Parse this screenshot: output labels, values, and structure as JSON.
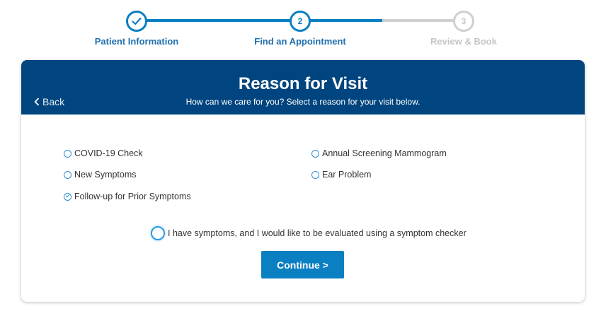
{
  "stepper": {
    "steps": [
      {
        "label": "Patient Information",
        "number": "",
        "state": "completed"
      },
      {
        "label": "Find an Appointment",
        "number": "2",
        "state": "current"
      },
      {
        "label": "Review & Book",
        "number": "3",
        "state": "upcoming"
      }
    ]
  },
  "card": {
    "title": "Reason for Visit",
    "subtitle": "How can we care for you? Select a reason for your visit below.",
    "back_label": "Back"
  },
  "reasons": [
    {
      "label": "COVID-19 Check",
      "selected": false
    },
    {
      "label": "New Symptoms",
      "selected": false
    },
    {
      "label": "Follow-up for Prior Symptoms",
      "selected": true
    },
    {
      "label": "Annual Screening Mammogram",
      "selected": false
    },
    {
      "label": "Ear Problem",
      "selected": false
    }
  ],
  "symptom_checker": {
    "label": "I have symptoms, and I would like to be evaluated using a symptom checker",
    "selected": false
  },
  "continue_label": "Continue >",
  "colors": {
    "header_bg": "#00457f",
    "accent": "#0a7fc2",
    "inactive": "#d0d0d0"
  },
  "icons": {
    "completed_step": "check-icon",
    "back": "chevron-left-icon"
  }
}
